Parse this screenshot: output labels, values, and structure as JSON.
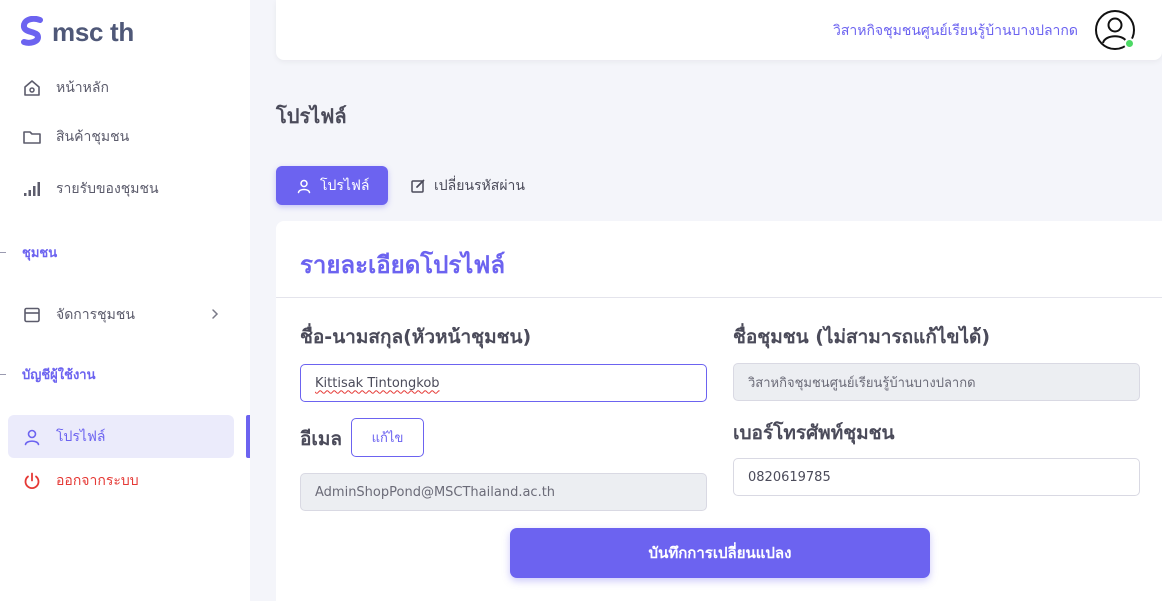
{
  "brand": {
    "name": "msc th"
  },
  "colors": {
    "accent": "#6c63f0",
    "danger": "#e53935",
    "online": "#4cd964"
  },
  "sidebar": {
    "items": [
      {
        "label": "หน้าหลัก",
        "icon": "home-icon"
      },
      {
        "label": "สินค้าชุมชน",
        "icon": "folder-icon"
      },
      {
        "label": "รายรับของชุมชน",
        "icon": "bar-chart-icon"
      }
    ],
    "section_community": "ชุมชน",
    "manage_community": {
      "label": "จัดการชุมชน",
      "icon": "calendar-icon"
    },
    "section_account": "บัญชีผู้ใช้งาน",
    "profile": {
      "label": "โปรไฟล์",
      "icon": "user-icon"
    },
    "logout": {
      "label": "ออกจากระบบ",
      "icon": "power-icon"
    }
  },
  "header": {
    "community_name": "วิสาหกิจชุมชนศูนย์เรียนรู้บ้านบางปลากด",
    "avatar_icon": "user-circle-icon"
  },
  "page": {
    "title": "โปรไฟล์",
    "tabs": [
      {
        "label": "โปรไฟล์",
        "icon": "user-icon"
      },
      {
        "label": "เปลี่ยนรหัสผ่าน",
        "icon": "edit-icon"
      }
    ]
  },
  "card": {
    "title": "รายละเอียดโปรไฟล์",
    "name_label": "ชื่อ-นามสกุล(หัวหน้าชุมชน)",
    "name_value": "Kittisak Tintongkob",
    "community_label": "ชื่อชุมชน (ไม่สามารถแก้ไขได้)",
    "community_value": "วิสาหกิจชุมชนศูนย์เรียนรู้บ้านบางปลากด",
    "email_label": "อีเมล",
    "email_edit": "แก้ไข",
    "email_value": "AdminShopPond@MSCThailand.ac.th",
    "phone_label": "เบอร์โทรศัพท์ชุมชน",
    "phone_value": "0820619785",
    "save_label": "บันทึกการเปลี่ยนแปลง"
  }
}
